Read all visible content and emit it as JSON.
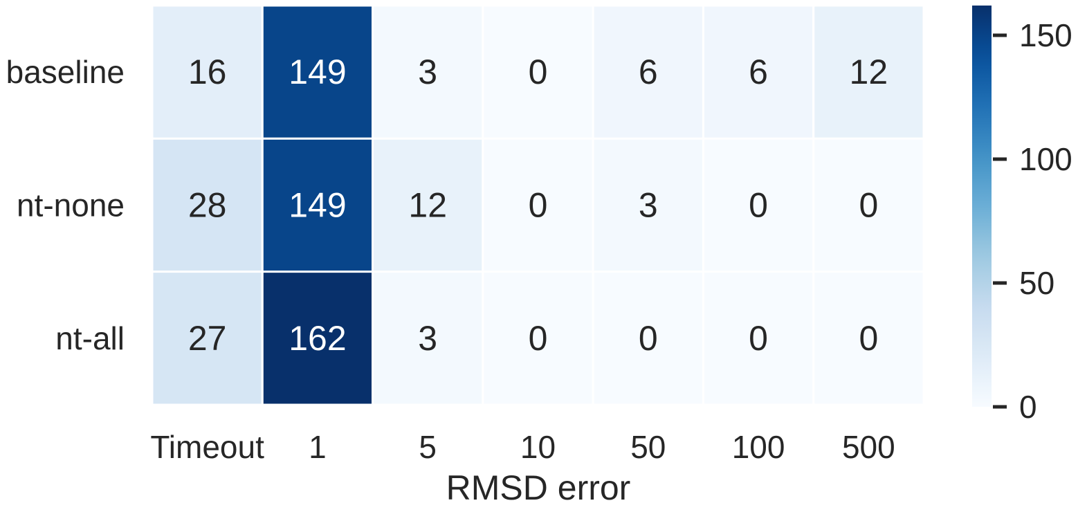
{
  "chart_data": {
    "type": "heatmap",
    "title": "",
    "xlabel": "RMSD error",
    "ylabel": "",
    "columns": [
      "Timeout",
      "1",
      "5",
      "10",
      "50",
      "100",
      "500"
    ],
    "rows": [
      "baseline",
      "nt-none",
      "nt-all"
    ],
    "values": [
      [
        16,
        149,
        3,
        0,
        6,
        6,
        12
      ],
      [
        28,
        149,
        12,
        0,
        3,
        0,
        0
      ],
      [
        27,
        162,
        3,
        0,
        0,
        0,
        0
      ]
    ],
    "colormap": "Blues",
    "color_range": [
      0,
      162
    ],
    "colorbar_ticks": [
      0,
      50,
      100,
      150
    ],
    "colorbar_tick_labels": [
      "0",
      "50",
      "100",
      "150"
    ],
    "grid_lines": "white",
    "annotated": true
  }
}
